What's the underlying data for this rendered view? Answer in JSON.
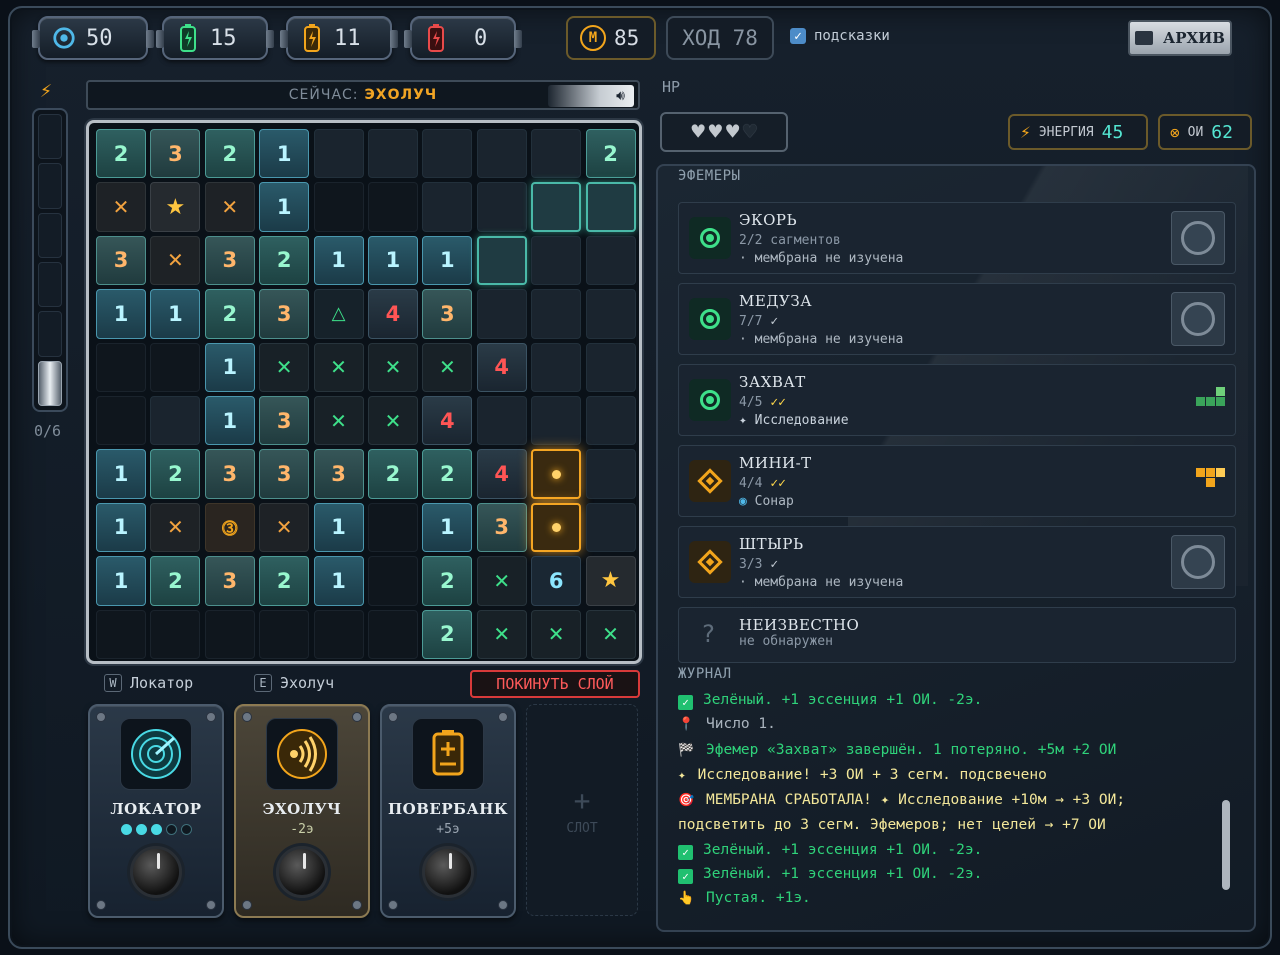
{
  "topbar": {
    "counters": [
      {
        "name": "target",
        "value": "50",
        "color": "#4fb8e8",
        "icon": "target-icon"
      },
      {
        "name": "green-cell",
        "value": "15",
        "color": "#3ee08a",
        "icon": "green-battery-icon"
      },
      {
        "name": "orange-cell",
        "value": "11",
        "color": "#f2a51c",
        "icon": "orange-battery-icon"
      },
      {
        "name": "red-cell",
        "value": "0",
        "color": "#e84a4a",
        "icon": "red-battery-icon"
      }
    ],
    "coins": "85",
    "coin_symbol": "M",
    "turn": "ХОД 78",
    "hints_label": "подсказки",
    "hints_checked": true,
    "archive_label": "АРХИВ"
  },
  "left": {
    "now_label": "СЕЙЧАС:",
    "now_value": "ЭХОЛУЧ",
    "gauge_text": "0/6",
    "gauge_filled": 1,
    "gauge_segments": 6
  },
  "grid": [
    [
      "n2",
      "n3",
      "n2",
      "n1",
      "o",
      "o",
      "o",
      "o",
      "o",
      "n2"
    ],
    [
      "x",
      "star",
      "x",
      "n1",
      "d",
      "d",
      "o",
      "o",
      "glow",
      "glow"
    ],
    [
      "n3",
      "x",
      "n3",
      "n2",
      "n1",
      "n1",
      "n1",
      "glow",
      "o",
      "o"
    ],
    [
      "n1",
      "n1",
      "n2",
      "n3",
      "tri",
      "n4",
      "n3",
      "o",
      "o",
      "o"
    ],
    [
      "d",
      "d",
      "n1",
      "gx",
      "gx",
      "gx",
      "gx",
      "n4",
      "o",
      "o"
    ],
    [
      "d",
      "o",
      "n1",
      "n3",
      "gx",
      "gx",
      "n4",
      "o",
      "o",
      "o"
    ],
    [
      "n1",
      "n2",
      "n3",
      "n3",
      "n3",
      "n2",
      "n2",
      "n4",
      "probe",
      "o"
    ],
    [
      "n1",
      "x",
      "coin",
      "x",
      "n1",
      "d",
      "n1",
      "n3",
      "probe",
      "o"
    ],
    [
      "n1",
      "n2",
      "n3",
      "n2",
      "n1",
      "d",
      "n2",
      "gx",
      "n6",
      "star"
    ],
    [
      "d",
      "d",
      "d",
      "d",
      "d",
      "d",
      "n2",
      "gx",
      "gx",
      "gx"
    ]
  ],
  "tools": {
    "key_w": "W",
    "key_w_label": "Локатор",
    "key_e": "E",
    "key_e_label": "Эхолуч",
    "leave_label": "ПОКИНУТЬ СЛОЙ",
    "locator": {
      "name": "ЛОКАТОР",
      "charges": 3,
      "max": 5
    },
    "echo": {
      "name": "ЭХОЛУЧ",
      "cost": "-2э"
    },
    "powerbank": {
      "name": "ПОВЕРБАНК",
      "gain": "+5э"
    },
    "slot_label": "СЛОТ"
  },
  "right": {
    "hp_label": "HP",
    "hearts_full": 3,
    "hearts_total": 4,
    "energy_label": "ЭНЕРГИЯ",
    "energy_value": "45",
    "oi_label": "ОИ",
    "oi_value": "62",
    "ephemera_title": "ЭФЕМЕРЫ",
    "ephemera": [
      {
        "name": "ЭКОРЬ",
        "line2": "2/2 сагментов",
        "line3": "· мембрана не изучена",
        "kind": "green",
        "badge": "seal"
      },
      {
        "name": "МЕДУЗА",
        "line2": "7/7",
        "line2_check": "✓",
        "line3": "· мембрана не изучена",
        "kind": "green",
        "badge": "seal"
      },
      {
        "name": "ЗАХВАТ",
        "line2": "4/5",
        "line2_check": "✓✓",
        "line3": "✦ Исследование",
        "kind": "green",
        "badge": "green-shape"
      },
      {
        "name": "МИНИ-Т",
        "line2": "4/4",
        "line2_check": "✓✓",
        "line3": "Сонар",
        "kind": "orange",
        "badge": "orange-shape"
      },
      {
        "name": "ШТЫРЬ",
        "line2": "3/3",
        "line2_check": "✓",
        "line3": "· мембрана не изучена",
        "kind": "orange",
        "badge": "seal"
      },
      {
        "name": "НЕИЗВЕСТНО",
        "line2": "не обнаружен",
        "line3": "",
        "kind": "unknown",
        "badge": "none"
      }
    ],
    "journal_title": "ЖУРНАЛ",
    "journal": [
      {
        "icon": "✓",
        "type": "check",
        "cls": "g",
        "text": "Зелёный. +1 эссенция +1 ОИ. -2э."
      },
      {
        "icon": "📍",
        "type": "pin",
        "cls": "w",
        "text": "Число 1."
      },
      {
        "icon": "🏁",
        "type": "flag",
        "cls": "g",
        "text": "Эфемер «Захват» завершён. 1 потеряно. +5м +2 ОИ"
      },
      {
        "icon": "✦",
        "type": "spark",
        "cls": "y",
        "text": "Исследование! +3 ОИ + 3 сегм. подсвечено"
      },
      {
        "icon": "🎯",
        "type": "target",
        "cls": "y",
        "text": "МЕМБРАНА СРАБОТАЛА! ✦ Исследование +10м → +3 ОИ;"
      },
      {
        "icon": "",
        "type": "cont",
        "cls": "y",
        "text": "подсветить до 3 сегм. Эфемеров; нет целей → +7 ОИ"
      },
      {
        "icon": "✓",
        "type": "check",
        "cls": "g",
        "text": "Зелёный. +1 эссенция +1 ОИ. -2э."
      },
      {
        "icon": "✓",
        "type": "check",
        "cls": "g",
        "text": "Зелёный. +1 эссенция +1 ОИ. -2э."
      },
      {
        "icon": "👆",
        "type": "tap",
        "cls": "g",
        "text": "Пустая. +1э."
      }
    ]
  }
}
